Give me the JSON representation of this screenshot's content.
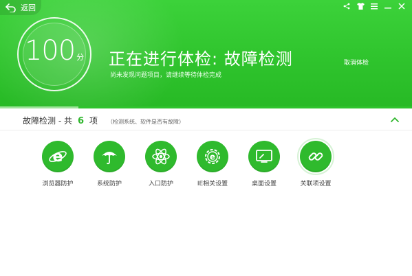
{
  "header": {
    "back_label": "返回",
    "score_value": "100",
    "score_unit": "分",
    "title": "正在进行体检: 故障检测",
    "subtitle": "尚未发现问题项目，请继续等待体检完成",
    "cancel_label": "取消体检",
    "progress_percent": 19
  },
  "window_controls": [
    {
      "icon": "share-icon",
      "glyph": "<"
    },
    {
      "icon": "shirt-icon",
      "glyph": "T"
    },
    {
      "icon": "menu-icon",
      "glyph": "≡"
    },
    {
      "icon": "minimize-icon",
      "glyph": "—"
    },
    {
      "icon": "close-icon",
      "glyph": "✕"
    }
  ],
  "section": {
    "title": "故障检测 - 共",
    "count": "6",
    "unit": "项",
    "description": "（检测系统、软件是否有故障）"
  },
  "items": [
    {
      "label": "浏览器防护",
      "icon": "ie-browser-icon"
    },
    {
      "label": "系统防护",
      "icon": "umbrella-icon"
    },
    {
      "label": "入口防护",
      "icon": "atom-icon"
    },
    {
      "label": "IE相关设置",
      "icon": "ie-settings-icon"
    },
    {
      "label": "桌面设置",
      "icon": "desktop-icon"
    },
    {
      "label": "关联项设置",
      "icon": "link-icon"
    }
  ],
  "colors": {
    "brand_green": "#2fc42d",
    "accent_green": "#2fb62d"
  }
}
